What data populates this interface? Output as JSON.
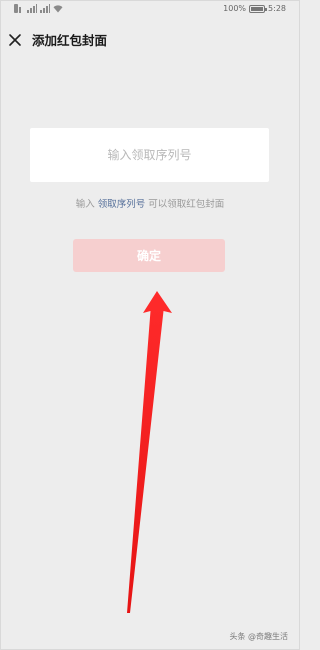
{
  "status_bar": {
    "battery": "100%",
    "battery_level": 1.0,
    "time": "5:28"
  },
  "nav": {
    "close_icon": "close-icon",
    "title": "添加红包封面"
  },
  "redeem": {
    "placeholder": "输入领取序列号",
    "value": "",
    "hint_prefix": "输入 ",
    "hint_link": "领取序列号",
    "hint_suffix": " 可以领取红包封面",
    "confirm_label": "确定"
  },
  "annotation": {
    "arrow_color": "#ff2020"
  },
  "colors": {
    "page_bg": "#ededed",
    "confirm_bg": "#f6cfcf",
    "link": "#56709a"
  },
  "watermark": "头条 @奇趣生活"
}
